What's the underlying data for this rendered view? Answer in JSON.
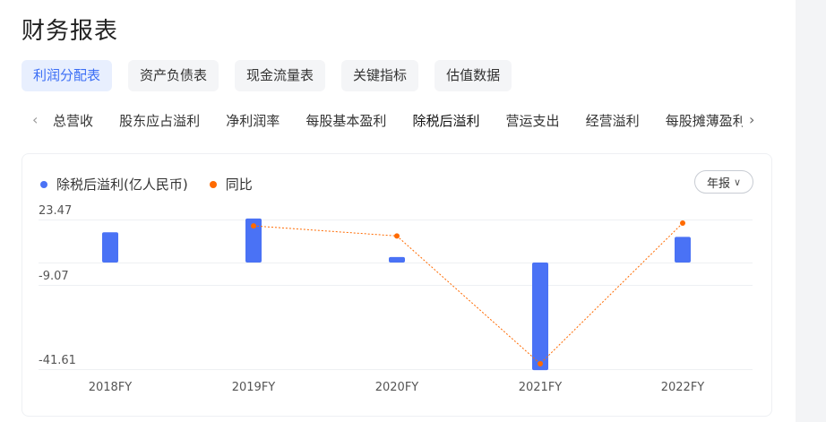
{
  "page": {
    "title": "财务报表"
  },
  "tabs": [
    {
      "label": "利润分配表",
      "active": true
    },
    {
      "label": "资产负债表",
      "active": false
    },
    {
      "label": "现金流量表",
      "active": false
    },
    {
      "label": "关键指标",
      "active": false
    },
    {
      "label": "估值数据",
      "active": false
    }
  ],
  "subtabs": [
    {
      "label": "总营收",
      "active": false
    },
    {
      "label": "股东应占溢利",
      "active": false
    },
    {
      "label": "净利润率",
      "active": false
    },
    {
      "label": "每股基本盈利",
      "active": false
    },
    {
      "label": "除税后溢利",
      "active": true
    },
    {
      "label": "营运支出",
      "active": false
    },
    {
      "label": "经营溢利",
      "active": false
    },
    {
      "label": "每股摊薄盈利",
      "active": false
    }
  ],
  "icons": {
    "prev": "chevron-left-icon",
    "next": "chevron-right-icon",
    "period_caret": "chevron-down-icon"
  },
  "legend": {
    "bar_label": "除税后溢利(亿人民币)",
    "line_label": "同比"
  },
  "period_select": {
    "label": "年报"
  },
  "colors": {
    "accent": "#3b6ef5",
    "bar": "#4a72f5",
    "line": "#ff6a00"
  },
  "chart_data": {
    "type": "bar",
    "categories": [
      "2018FY",
      "2019FY",
      "2020FY",
      "2021FY",
      "2022FY"
    ],
    "y_ticks": [
      "23.47",
      "-9.07",
      "-41.61"
    ],
    "ylim": [
      -41.61,
      23.47
    ],
    "series": [
      {
        "name": "除税后溢利(亿人民币)",
        "type": "bar",
        "values": [
          16.5,
          24.0,
          3.0,
          -42.0,
          14.0
        ]
      },
      {
        "name": "同比",
        "type": "line",
        "values": [
          null,
          20.0,
          14.5,
          -39.5,
          21.5
        ]
      }
    ],
    "grid": true,
    "legend_position": "top-left"
  }
}
